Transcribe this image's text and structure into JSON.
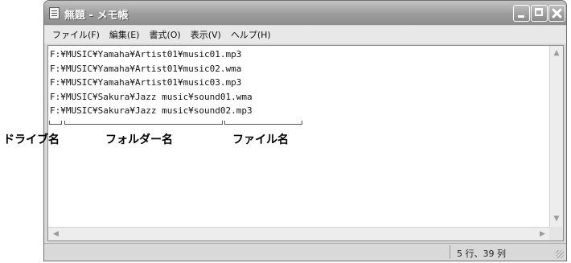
{
  "window": {
    "title": "無題 - メモ帳"
  },
  "menu": [
    "ファイル(F)",
    "編集(E)",
    "書式(O)",
    "表示(V)",
    "ヘルプ(H)"
  ],
  "editor": {
    "lines": [
      "F:¥MUSIC¥Yamaha¥Artist01¥music01.mp3",
      "F:¥MUSIC¥Yamaha¥Artist01¥music02.wma",
      "F:¥MUSIC¥Yamaha¥Artist01¥music03.mp3",
      "F:¥MUSIC¥Sakura¥Jazz music¥sound01.wma",
      "F:¥MUSIC¥Sakura¥Jazz music¥sound02.mp3"
    ]
  },
  "status": {
    "position": "5 行、39 列"
  },
  "annotations": {
    "drive": "ドライブ名",
    "folder": "フォルダー名",
    "file": "ファイル名"
  },
  "icons": {
    "app": "notepad-icon",
    "minimize": "minimize-icon",
    "maximize": "maximize-icon",
    "close": "close-icon"
  }
}
